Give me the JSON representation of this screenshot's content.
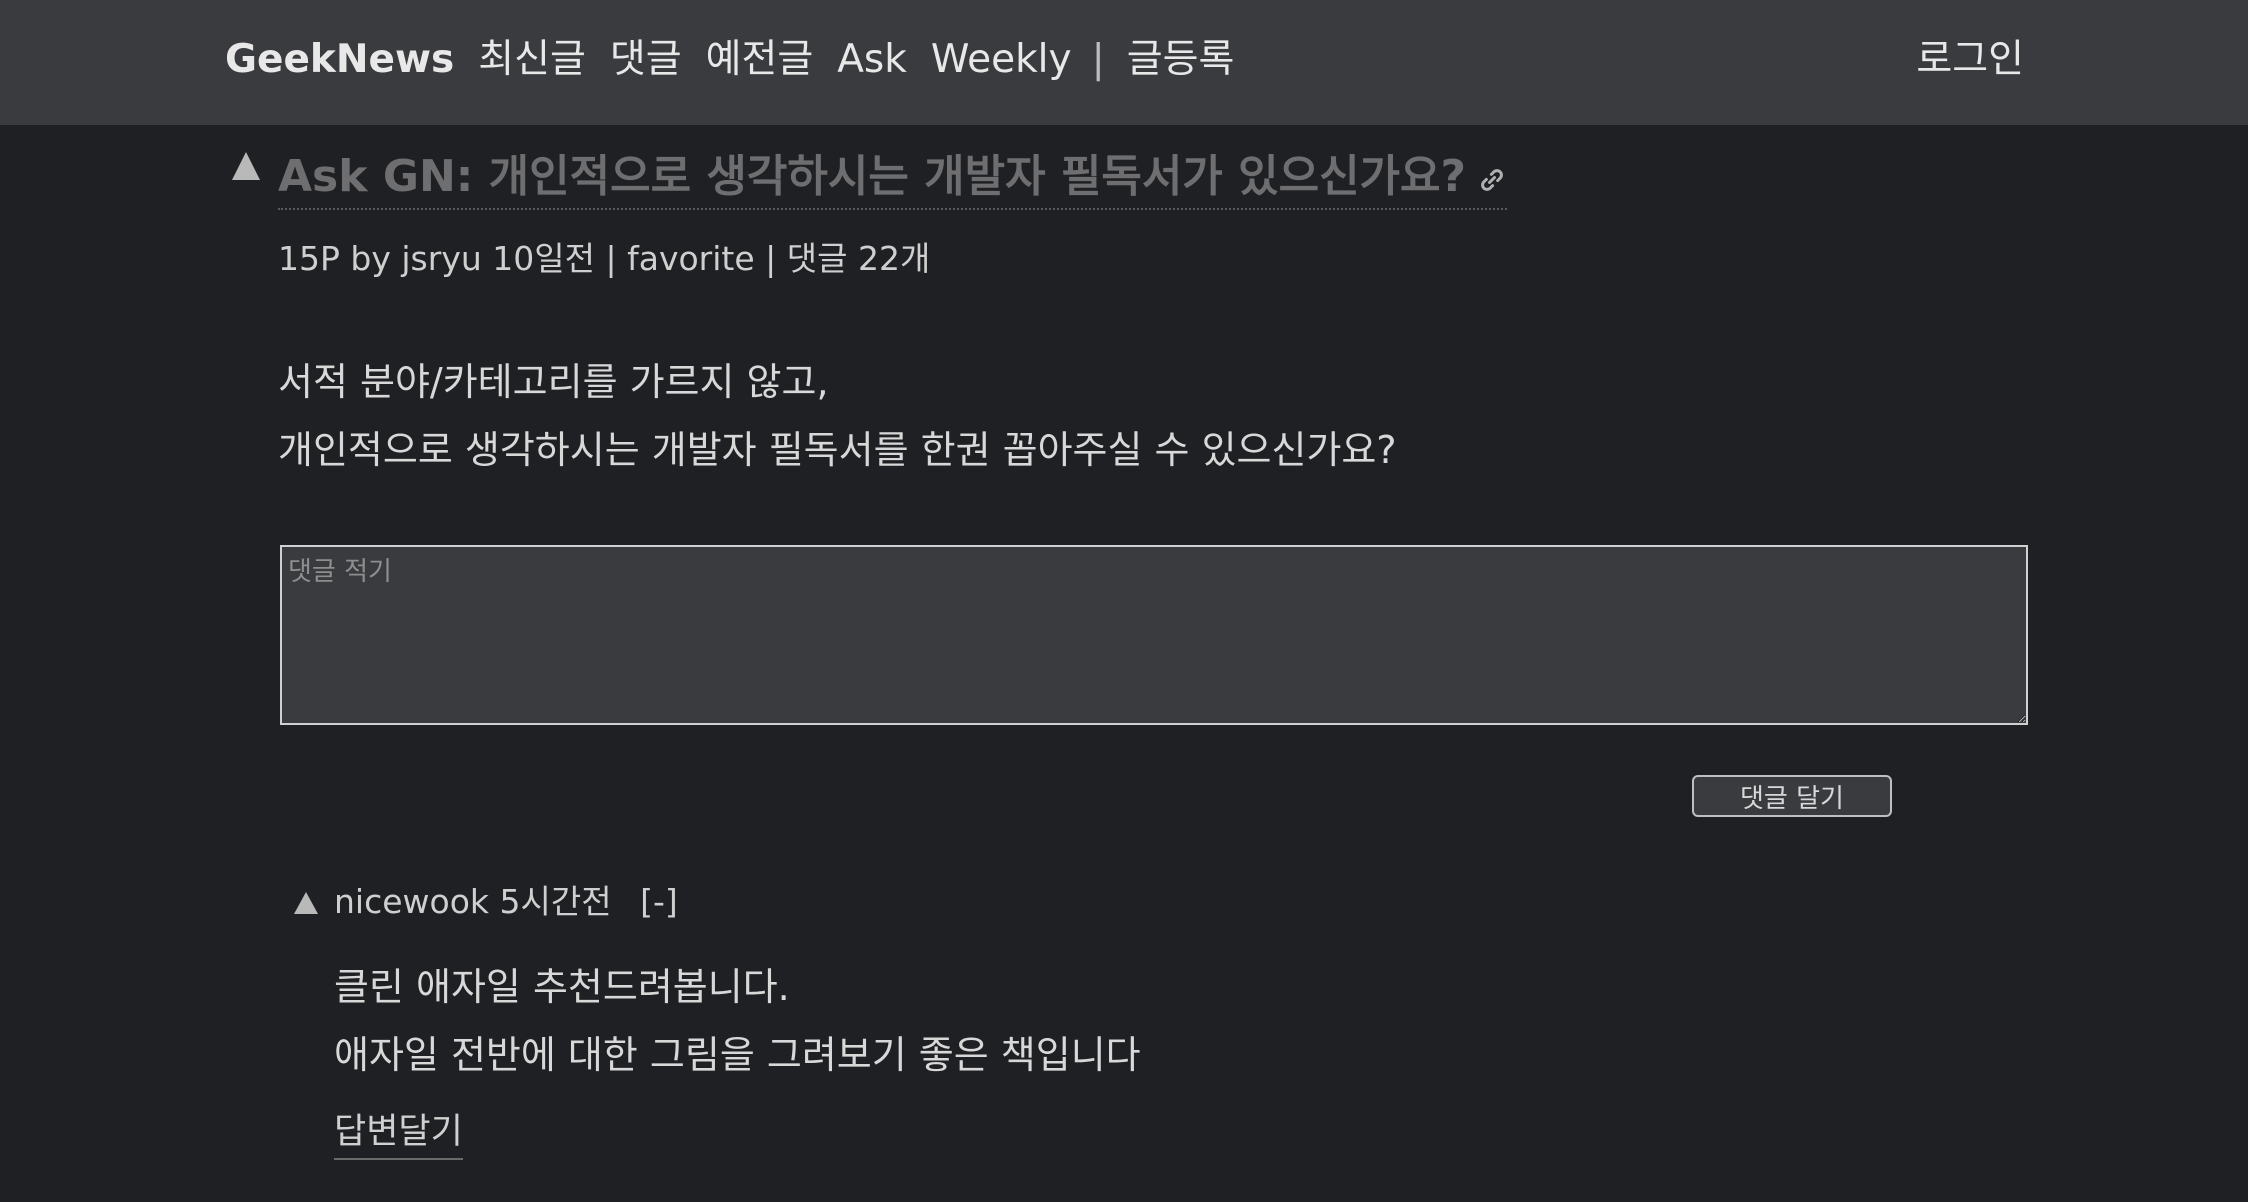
{
  "nav": {
    "brand": "GeekNews",
    "items": [
      "최신글",
      "댓글",
      "예전글",
      "Ask",
      "Weekly"
    ],
    "separator": "|",
    "submit": "글등록",
    "login": "로그인"
  },
  "post": {
    "title": "Ask GN: 개인적으로 생각하시는 개발자 필독서가 있으신가요?",
    "points": "15P",
    "by": "by",
    "author": "jsryu",
    "time": "10일전",
    "sep": "|",
    "favorite": "favorite",
    "comments": "댓글 22개",
    "body": [
      "서적 분야/카테고리를 가르지 않고,",
      "개인적으로 생각하시는 개발자 필독서를 한권 꼽아주실 수 있으신가요?"
    ]
  },
  "comment_form": {
    "placeholder": "댓글 적기",
    "submit_label": "댓글 달기"
  },
  "comments": [
    {
      "author": "nicewook",
      "time": "5시간전",
      "collapse": "[-]",
      "body": [
        "클린 애자일 추천드려봅니다.",
        "애자일 전반에 대한 그림을 그려보기 좋은 책입니다"
      ],
      "reply_label": "답변달기"
    }
  ],
  "colors": {
    "background": "#1f2023",
    "topbar": "#3a3b3f",
    "title": "#6e6e70"
  }
}
